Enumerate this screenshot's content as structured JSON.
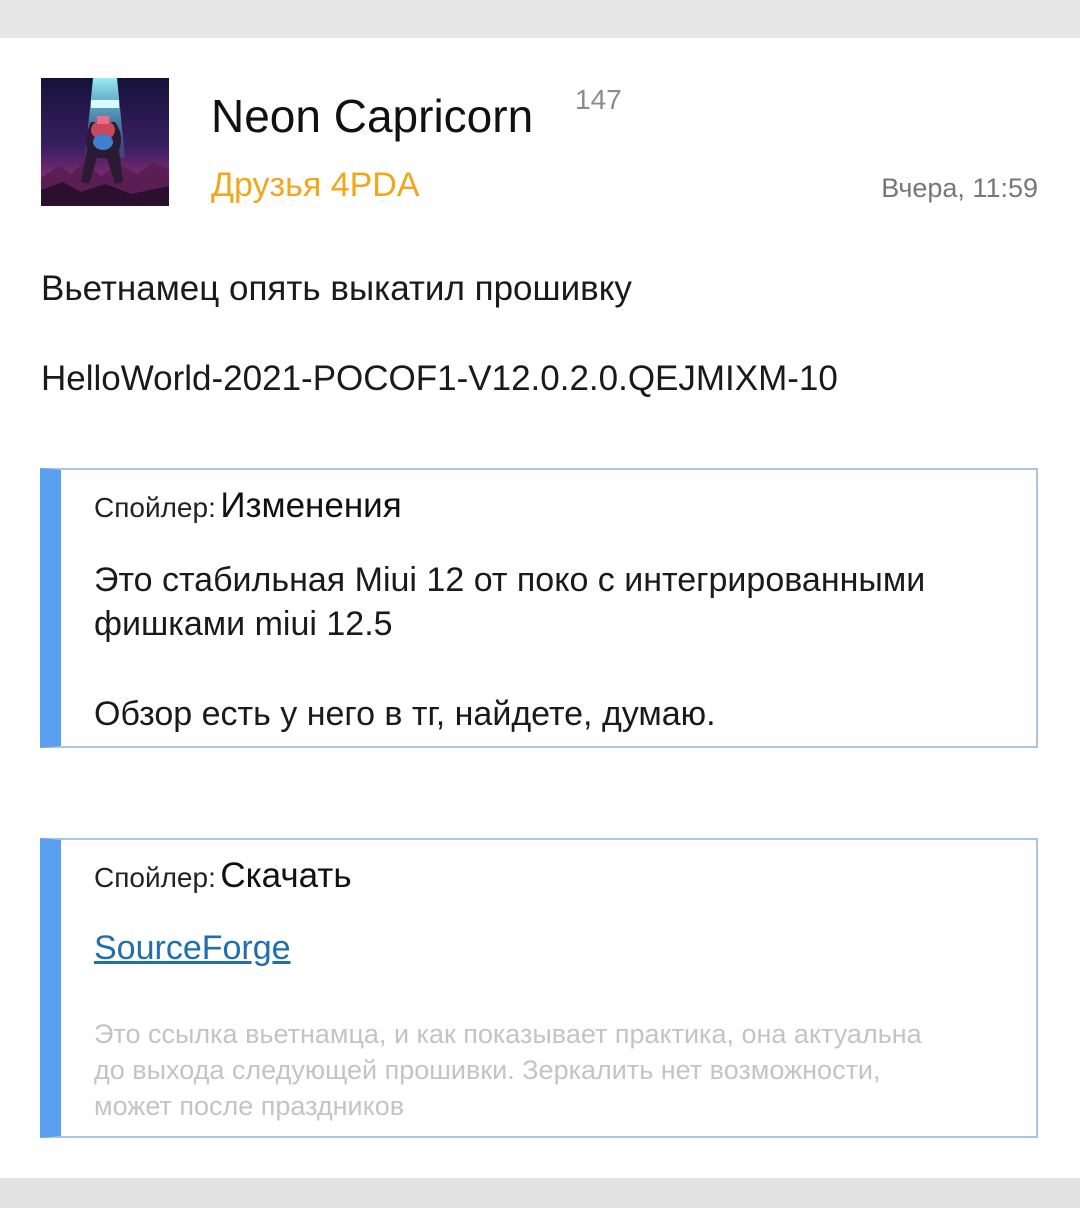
{
  "post": {
    "author": {
      "name": "Neon Capricorn",
      "reputation": "147",
      "group": "Друзья 4PDA",
      "avatar_icon": "avatar-image"
    },
    "timestamp": "Вчера, 11:59",
    "lines": [
      "Вьетнамец опять выкатил прошивку",
      "HelloWorld-2021-POCOF1-V12.0.2.0.QEJMIXM-10"
    ],
    "spoilers": [
      {
        "label": "Спойлер:",
        "title": "Изменения",
        "lines": [
          "Это стабильная Miui 12 от поко с интегрированными",
          "фишками miui 12.5",
          "Обзор есть у него в тг, найдете, думаю."
        ]
      },
      {
        "label": "Спойлер:",
        "title": "Скачать",
        "link": "SourceForge",
        "note_lines": [
          "Это ссылка вьетнамца, и как показывает практика, она актуальна",
          "до выхода следующей прошивки. Зеркалить нет возможности,",
          "может после праздников"
        ]
      }
    ]
  },
  "colors": {
    "group": "#f2a71b",
    "spoiler_accent": "#5aa0ee",
    "spoiler_border": "#aac4e6",
    "link": "#1f6fb0",
    "note": "#c4c4c4"
  }
}
